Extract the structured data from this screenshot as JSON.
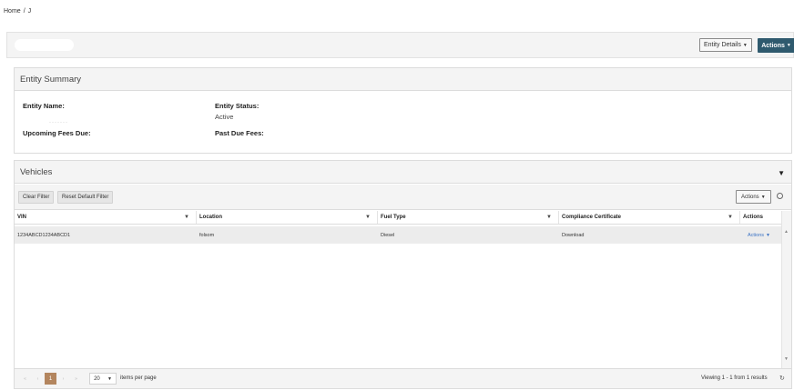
{
  "breadcrumb": {
    "home": "Home",
    "sep": "/",
    "current": "J"
  },
  "header": {
    "entity_details_label": "Entity Details",
    "actions_label": "Actions"
  },
  "summary": {
    "title": "Entity Summary",
    "entity_name_label": "Entity Name:",
    "entity_status_label": "Entity Status:",
    "entity_status_value": "Active",
    "upcoming_fees_label": "Upcoming Fees Due:",
    "past_due_label": "Past Due Fees:"
  },
  "vehicles": {
    "title": "Vehicles",
    "clear_filter": "Clear Filter",
    "reset_filter": "Reset Default Filter",
    "actions_label": "Actions",
    "columns": [
      "VIN",
      "Location",
      "Fuel Type",
      "Compliance Certificate",
      "Actions"
    ],
    "rows": [
      {
        "vin": "1234ABCD1234ABCD1",
        "location": "folsom",
        "fuel": "Diesel",
        "certificate": "Download",
        "actions": "Actions"
      }
    ]
  },
  "pager": {
    "current_page": "1",
    "page_size": "20",
    "items_per_page": "items per page",
    "viewing": "Viewing 1 - 1 from 1 results"
  },
  "icons": {
    "caret": "caret-down",
    "filter": "filter",
    "collapse": "triangle-down",
    "settings": "gear",
    "refresh": "refresh"
  }
}
